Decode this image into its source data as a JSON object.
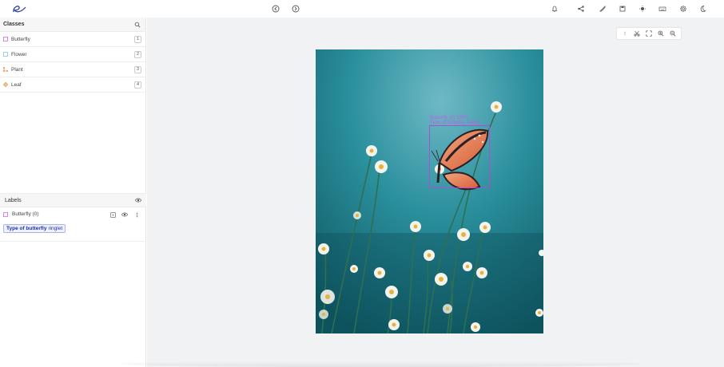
{
  "toolbar": {
    "icons": [
      "app-logo",
      "undo-icon",
      "redo-icon",
      "bell-icon",
      "share-icon",
      "tag-icon",
      "save-icon",
      "brightness-icon",
      "keyboard-icon",
      "gear-icon",
      "moon-icon"
    ]
  },
  "classes": {
    "title": "Classes",
    "items": [
      {
        "name": "Butterfly",
        "shortcut": "1",
        "color": "#c040e0"
      },
      {
        "name": "Flower",
        "shortcut": "2",
        "color": "#66b8e0"
      },
      {
        "name": "Plant",
        "shortcut": "3",
        "color": "#e07030"
      },
      {
        "name": "Leaf",
        "shortcut": "4",
        "color": "#e09040"
      }
    ]
  },
  "labels": {
    "title": "Labels",
    "items": [
      {
        "name": "Butterfly (0)",
        "attribute_key": "Type of butterfly",
        "attribute_value": "ringlet"
      }
    ]
  },
  "annotation": {
    "line1": "Butterfly (0)  100%",
    "line2": "Type of butterfly: ringlet"
  },
  "colors": {
    "accent": "#b04cd8"
  }
}
